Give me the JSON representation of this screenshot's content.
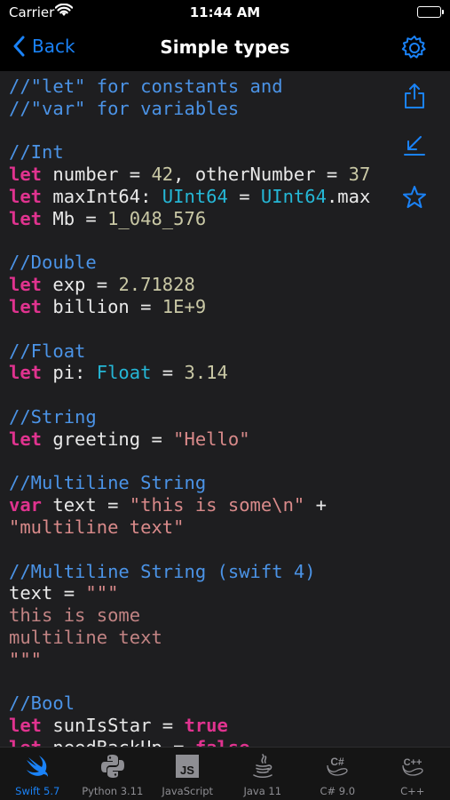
{
  "status_bar": {
    "carrier": "Carrier",
    "time": "11:44 AM",
    "battery_level": 1.0
  },
  "nav": {
    "back_label": "Back",
    "title": "Simple types",
    "settings_icon": "gear-icon"
  },
  "side_actions": [
    {
      "icon": "share-icon"
    },
    {
      "icon": "download-arrow-icon"
    },
    {
      "icon": "star-icon"
    }
  ],
  "colors": {
    "accent": "#1a82f7",
    "comment": "#4b93e6",
    "keyword": "#e0338f",
    "number": "#c9c8a5",
    "type": "#25b7d6",
    "string": "#d98a8a",
    "background": "#1e1e20"
  },
  "code": {
    "lines": [
      [
        {
          "t": "comment",
          "v": "//\"let\" for constants and"
        }
      ],
      [
        {
          "t": "comment",
          "v": "//\"var\" for variables"
        }
      ],
      [],
      [
        {
          "t": "comment",
          "v": "//Int"
        }
      ],
      [
        {
          "t": "kw",
          "v": "let"
        },
        {
          "t": "plain",
          "v": " number = "
        },
        {
          "t": "num",
          "v": "42"
        },
        {
          "t": "plain",
          "v": ", otherNumber = "
        },
        {
          "t": "num",
          "v": "37"
        }
      ],
      [
        {
          "t": "kw",
          "v": "let"
        },
        {
          "t": "plain",
          "v": " maxInt64: "
        },
        {
          "t": "type",
          "v": "UInt64"
        },
        {
          "t": "plain",
          "v": " = "
        },
        {
          "t": "type",
          "v": "UInt64"
        },
        {
          "t": "plain",
          "v": ".max"
        }
      ],
      [
        {
          "t": "kw",
          "v": "let"
        },
        {
          "t": "plain",
          "v": " Mb = "
        },
        {
          "t": "num",
          "v": "1_048_576"
        }
      ],
      [],
      [
        {
          "t": "comment",
          "v": "//Double"
        }
      ],
      [
        {
          "t": "kw",
          "v": "let"
        },
        {
          "t": "plain",
          "v": " exp = "
        },
        {
          "t": "num",
          "v": "2.71828"
        }
      ],
      [
        {
          "t": "kw",
          "v": "let"
        },
        {
          "t": "plain",
          "v": " billion = "
        },
        {
          "t": "num",
          "v": "1E+9"
        }
      ],
      [],
      [
        {
          "t": "comment",
          "v": "//Float"
        }
      ],
      [
        {
          "t": "kw",
          "v": "let"
        },
        {
          "t": "plain",
          "v": " pi: "
        },
        {
          "t": "type",
          "v": "Float"
        },
        {
          "t": "plain",
          "v": " = "
        },
        {
          "t": "num",
          "v": "3.14"
        }
      ],
      [],
      [
        {
          "t": "comment",
          "v": "//String"
        }
      ],
      [
        {
          "t": "kw",
          "v": "let"
        },
        {
          "t": "plain",
          "v": " greeting = "
        },
        {
          "t": "str",
          "v": "\"Hello\""
        }
      ],
      [],
      [
        {
          "t": "comment",
          "v": "//Multiline String"
        }
      ],
      [
        {
          "t": "kw",
          "v": "var"
        },
        {
          "t": "plain",
          "v": " text = "
        },
        {
          "t": "str",
          "v": "\"this is some\\n\""
        },
        {
          "t": "plain",
          "v": " +"
        }
      ],
      [
        {
          "t": "str",
          "v": "\"multiline text\""
        }
      ],
      [],
      [
        {
          "t": "comment",
          "v": "//Multiline String (swift 4)"
        }
      ],
      [
        {
          "t": "plain",
          "v": "text = "
        },
        {
          "t": "str",
          "v": "\"\"\""
        }
      ],
      [
        {
          "t": "strtxt",
          "v": "this is some"
        }
      ],
      [
        {
          "t": "strtxt",
          "v": "multiline text"
        }
      ],
      [
        {
          "t": "str",
          "v": "\"\"\""
        }
      ],
      [],
      [
        {
          "t": "comment",
          "v": "//Bool"
        }
      ],
      [
        {
          "t": "kw",
          "v": "let"
        },
        {
          "t": "plain",
          "v": " sunIsStar = "
        },
        {
          "t": "kw",
          "v": "true"
        }
      ],
      [
        {
          "t": "kw",
          "v": "let"
        },
        {
          "t": "plain",
          "v": " needBackUp = "
        },
        {
          "t": "kw",
          "v": "false"
        }
      ]
    ]
  },
  "tabs": [
    {
      "label": "Swift 5.7",
      "icon": "swift-logo-icon",
      "active": true
    },
    {
      "label": "Python 3.11",
      "icon": "python-logo-icon",
      "active": false
    },
    {
      "label": "JavaScript",
      "icon": "javascript-logo-icon",
      "active": false
    },
    {
      "label": "Java 11",
      "icon": "java-logo-icon",
      "active": false
    },
    {
      "label": "C# 9.0",
      "icon": "csharp-logo-icon",
      "active": false
    },
    {
      "label": "C++",
      "icon": "cpp-logo-icon",
      "active": false
    }
  ],
  "tab_icon_texts": {
    "javascript": "JS",
    "csharp": "C#",
    "cpp": "C++"
  }
}
